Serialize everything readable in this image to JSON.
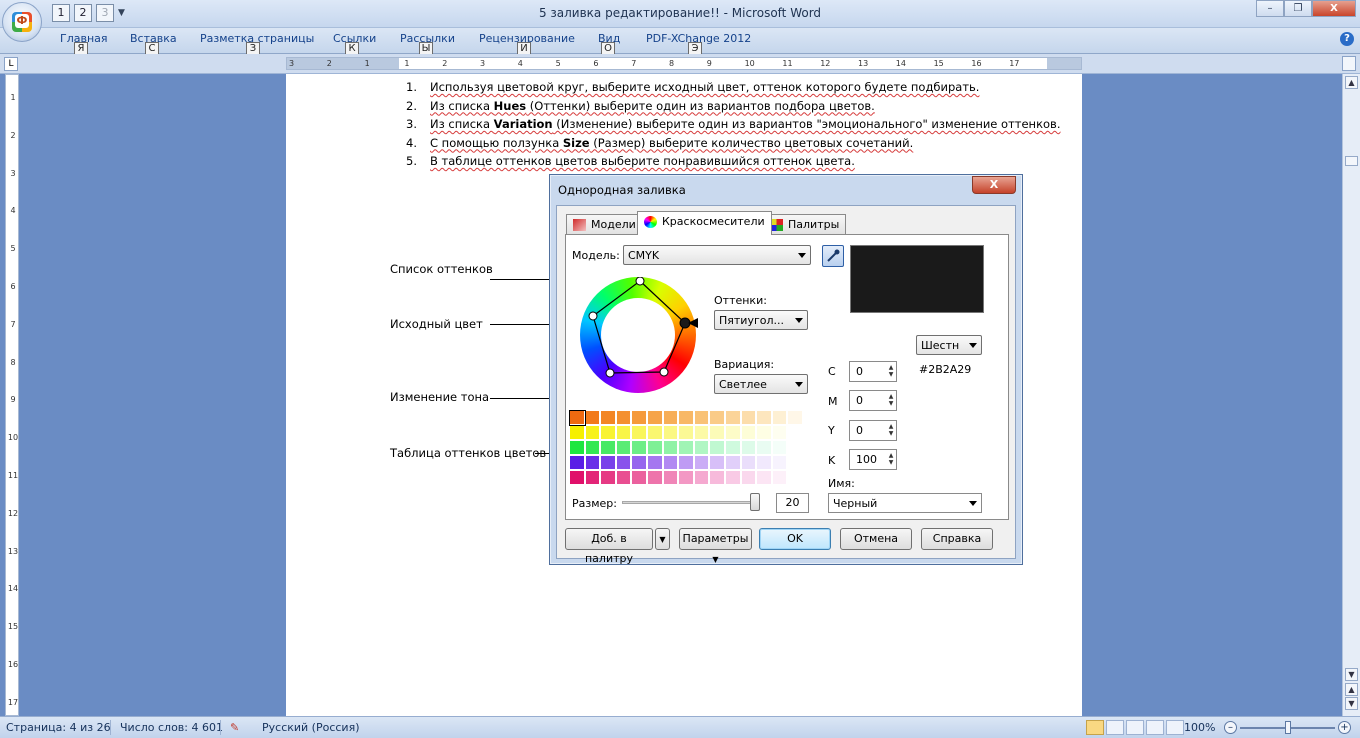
{
  "window": {
    "title": "5 заливка редактирование!! - Microsoft Word",
    "office_button_glyph": "Ф",
    "qat_keytips": [
      "1",
      "2",
      "3"
    ],
    "close_label": "X",
    "minimize_label": "–",
    "restore_label": "❐"
  },
  "ribbon": {
    "tabs": [
      {
        "label": "Главная",
        "keytip": "Я"
      },
      {
        "label": "Вставка",
        "keytip": "С"
      },
      {
        "label": "Разметка страницы",
        "keytip": "З"
      },
      {
        "label": "Ссылки",
        "keytip": "К"
      },
      {
        "label": "Рассылки",
        "keytip": "Ы"
      },
      {
        "label": "Рецензирование",
        "keytip": "И"
      },
      {
        "label": "Вид",
        "keytip": "О"
      },
      {
        "label": "PDF-XChange 2012",
        "keytip": "Э"
      }
    ],
    "help_glyph": "?"
  },
  "ruler": {
    "corner_glyph": "L",
    "h_numbers": [
      "3",
      "2",
      "1",
      "1",
      "2",
      "3",
      "4",
      "5",
      "6",
      "7",
      "8",
      "9",
      "10",
      "11",
      "12",
      "13",
      "14",
      "15",
      "16",
      "17"
    ],
    "v_numbers": [
      "1",
      "2",
      "3",
      "4",
      "5",
      "6",
      "7",
      "8",
      "9",
      "10",
      "11",
      "12",
      "13",
      "14",
      "15",
      "16",
      "17"
    ]
  },
  "document": {
    "steps": [
      {
        "n": "1.",
        "text": "Используя цветовой круг, выберите исходный цвет, оттенок которого будете подбирать."
      },
      {
        "n": "2.",
        "pre": "Из списка ",
        "bold": "Hues",
        "post": " (Оттенки) выберите один из вариантов подбора цветов."
      },
      {
        "n": "3.",
        "pre": "Из списка ",
        "bold": "Variation",
        "post": " (Изменение) выберите один из вариантов \"эмоционального\" изменение оттенков."
      },
      {
        "n": "4.",
        "pre": "С помощью ползунка ",
        "bold": "Size",
        "post": " (Размер) выберите количество цветовых сочетаний."
      },
      {
        "n": "5.",
        "text": "В таблице оттенков цветов выберите понравившийся оттенок цвета."
      }
    ],
    "callouts": [
      {
        "label": "Список оттенков"
      },
      {
        "label": "Исходный цвет"
      },
      {
        "label": "Изменение тона"
      },
      {
        "label": "Таблица оттенков цветов"
      }
    ]
  },
  "dialog": {
    "title": "Однородная заливка",
    "close_label": "X",
    "tabs": [
      {
        "label": "Модели",
        "active": false
      },
      {
        "label": "Краскосмесители",
        "active": true
      },
      {
        "label": "Палитры",
        "active": false
      }
    ],
    "model": {
      "label": "Модель:",
      "value": "CMYK"
    },
    "hues": {
      "label": "Оттенки:",
      "value": "Пятиугол..."
    },
    "variation": {
      "label": "Вариация:",
      "value": "Светлее"
    },
    "size": {
      "label": "Размер:",
      "value": "20",
      "fraction": 0.98
    },
    "format_button": "Шестн",
    "hex": "#2B2A29",
    "preview_color": "#1a1a1a",
    "channels": [
      {
        "name": "C",
        "value": "0"
      },
      {
        "name": "M",
        "value": "0"
      },
      {
        "name": "Y",
        "value": "0"
      },
      {
        "name": "K",
        "value": "100"
      }
    ],
    "name_label": "Имя:",
    "name_value": "Черный",
    "buttons": {
      "add_palette": "Доб. в палитру",
      "options": "Параметры",
      "ok": "OK",
      "cancel": "Отмена",
      "help": "Справка"
    },
    "shade_rows": [
      [
        "#ef6a10",
        "#f27a1a",
        "#f38624",
        "#f4902f",
        "#f59a3b",
        "#f6a449",
        "#f7ae57",
        "#f8b866",
        "#f9c276",
        "#facb87",
        "#fbd499",
        "#fcddab",
        "#fde6be",
        "#fef0d3",
        "#fff7e8"
      ],
      [
        "#f6f000",
        "#f7f21a",
        "#f8f331",
        "#f9f547",
        "#f9f65c",
        "#faf770",
        "#fbf883",
        "#fbf995",
        "#fcfaa7",
        "#fcfbb8",
        "#fdfcc8",
        "#fdfdd7",
        "#fefee4",
        "#fefef0",
        "#ffffff"
      ],
      [
        "#1ee640",
        "#33e853",
        "#47ea64",
        "#5aec75",
        "#6cee86",
        "#7ef096",
        "#8ff2a6",
        "#a0f4b5",
        "#b0f6c3",
        "#c0f8d1",
        "#cffade",
        "#ddfbe9",
        "#e9fcf2",
        "#f4fef9",
        "#ffffff"
      ],
      [
        "#5a1ee6",
        "#6a2fe8",
        "#7a41ea",
        "#8953ec",
        "#9765ee",
        "#a577f0",
        "#b289f2",
        "#bf9bf4",
        "#cbadf6",
        "#d7bff8",
        "#e1cffa",
        "#eadefb",
        "#f1e9fd",
        "#f7f3fe",
        "#ffffff"
      ],
      [
        "#e0106a",
        "#e32577",
        "#e63a84",
        "#e94e91",
        "#eb619e",
        "#ee74ab",
        "#f086b8",
        "#f398c4",
        "#f5a9d0",
        "#f7badb",
        "#f9cae5",
        "#fad8ed",
        "#fce5f4",
        "#fdf0f9",
        "#ffffff"
      ]
    ]
  },
  "status": {
    "page": "Страница: 4 из 26",
    "words": "Число слов: 4 601",
    "language": "Русский (Россия)",
    "zoom": "100%",
    "zoom_fraction": 0.5
  }
}
